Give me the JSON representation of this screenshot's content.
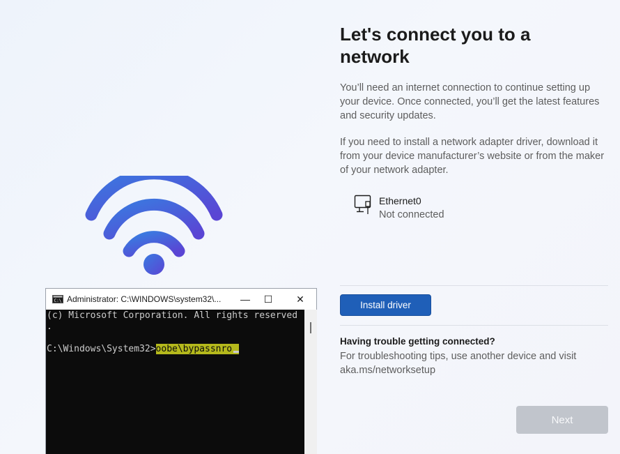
{
  "page": {
    "title": "Let's connect you to a network",
    "paragraph1": "You’ll need an internet connection to continue setting up your device. Once connected, you’ll get the latest features and security updates.",
    "paragraph2": "If you need to install a network adapter driver, download it from your device manufacturer’s website or from the maker of your network adapter."
  },
  "network": {
    "name": "Ethernet0",
    "status": "Not connected",
    "icon": "ethernet-icon"
  },
  "actions": {
    "install_driver_label": "Install driver",
    "next_label": "Next"
  },
  "help": {
    "title": "Having trouble getting connected?",
    "text": "For troubleshooting tips, use another device and visit aka.ms/networksetup"
  },
  "console": {
    "window_title": "Administrator: C:\\WINDOWS\\system32\\...",
    "lines": [
      "(c) Microsoft Corporation. All rights reserved",
      ".",
      ""
    ],
    "prompt": "C:\\Windows\\System32>",
    "command": "oobe\\bypassnro",
    "highlight_color": "#b5b91c"
  },
  "colors": {
    "accent": "#1f5fb8",
    "wifi_gradient_start": "#3b73d9",
    "wifi_gradient_end": "#5b47d6",
    "disabled": "#c1c5cc"
  }
}
